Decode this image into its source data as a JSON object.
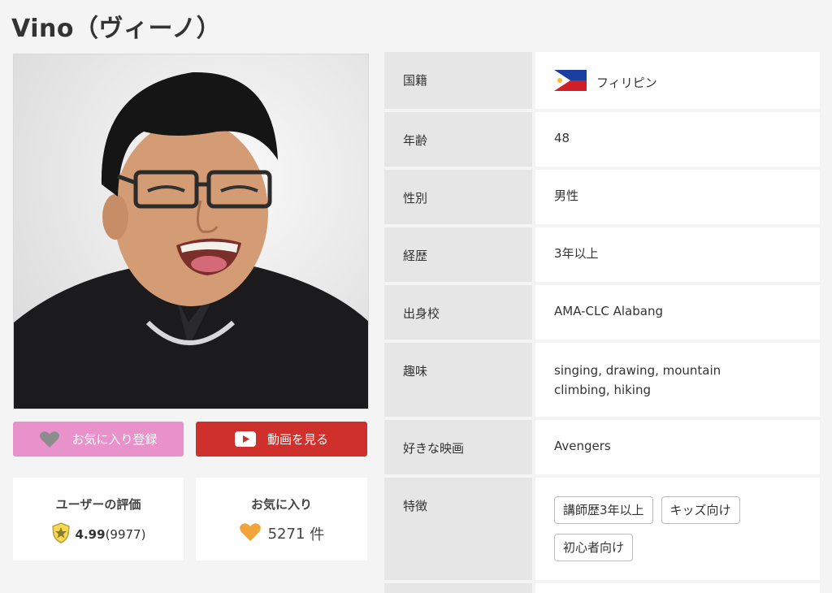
{
  "page": {
    "title": "Vino（ヴィーノ）"
  },
  "buttons": {
    "favorite_label": "お気に入り登録",
    "video_label": "動画を見る"
  },
  "rating": {
    "title": "ユーザーの評価",
    "value": "4.99",
    "count": "(9977)"
  },
  "favorites": {
    "title": "お気に入り",
    "count": "5271",
    "unit": "件"
  },
  "profile": {
    "nationality": {
      "label": "国籍",
      "value": "フィリピン"
    },
    "age": {
      "label": "年齢",
      "value": "48"
    },
    "gender": {
      "label": "性別",
      "value": "男性"
    },
    "experience": {
      "label": "経歴",
      "value": "3年以上"
    },
    "school": {
      "label": "出身校",
      "value": "AMA-CLC Alabang"
    },
    "hobby": {
      "label": "趣味",
      "value": "singing, drawing, mountain climbing, hiking"
    },
    "movie": {
      "label": "好きな映画",
      "value": "Avengers"
    },
    "features": {
      "label": "特徴",
      "tags": [
        "講師歴3年以上",
        "キッズ向け",
        "初心者向け"
      ]
    }
  },
  "colors": {
    "favorite_button": "#e891cb",
    "video_button": "#d0302b",
    "label_bg": "#e6e6e6",
    "heart_orange": "#f2a43a"
  },
  "icons": {
    "favorite": "heart-icon",
    "video": "play-icon",
    "rating": "star-badge-icon",
    "favorites": "heart-icon",
    "flag": "philippines-flag-icon"
  }
}
